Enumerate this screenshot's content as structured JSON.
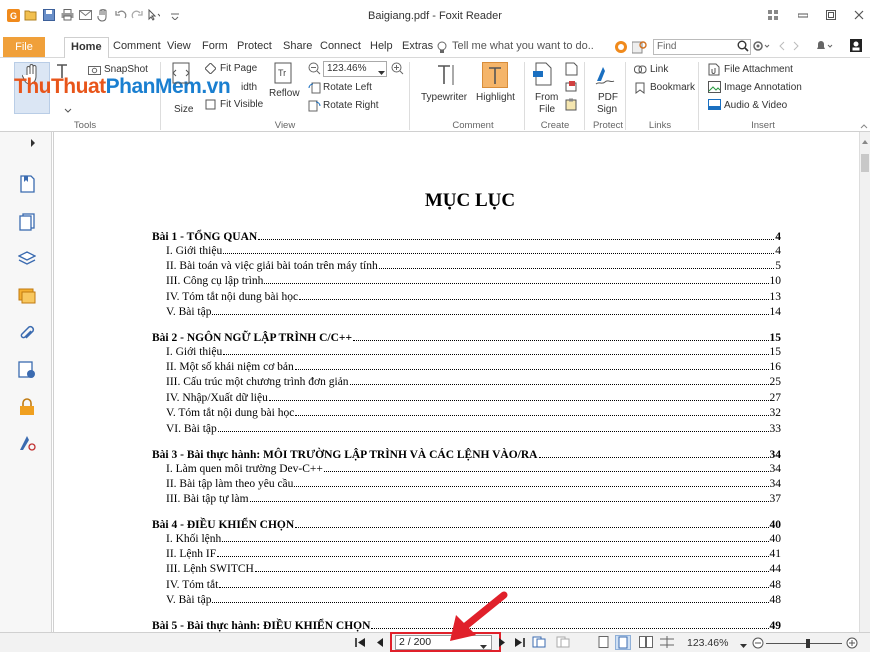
{
  "window": {
    "title": "Baigiang.pdf - Foxit Reader"
  },
  "menu": {
    "file": "File",
    "items": [
      "Home",
      "Comment",
      "View",
      "Form",
      "Protect",
      "Share",
      "Connect",
      "Help",
      "Extras"
    ],
    "tell_me": "Tell me what you want to do..",
    "search_placeholder": "Find"
  },
  "ribbon": {
    "tools": {
      "snapshot": "SnapShot",
      "group": "Tools"
    },
    "view": {
      "fit_page": "Fit Page",
      "fit_width_partial": "idth",
      "fit_visible": "Fit Visible",
      "size_partial": "Size",
      "reflow": "Reflow",
      "zoom": "123.46%",
      "rotate_left": "Rotate Left",
      "rotate_right": "Rotate Right",
      "group": "View"
    },
    "comment": {
      "typewriter": "Typewriter",
      "highlight": "Highlight",
      "group": "Comment"
    },
    "create": {
      "from_file_1": "From",
      "from_file_2": "File",
      "group": "Create"
    },
    "protect": {
      "pdf_sign_1": "PDF",
      "pdf_sign_2": "Sign",
      "group": "Protect"
    },
    "links": {
      "link": "Link",
      "bookmark": "Bookmark",
      "group": "Links"
    },
    "insert": {
      "file_attachment": "File Attachment",
      "image_annotation": "Image Annotation",
      "audio_video": "Audio & Video",
      "group": "Insert"
    }
  },
  "watermark": {
    "part1": "ThuThuat",
    "part2": "PhanMem",
    "part3": ".vn"
  },
  "document": {
    "title": "MỤC LỤC",
    "toc": [
      {
        "text": "Bài 1 - TỔNG QUAN",
        "page": "4",
        "level": "sec"
      },
      {
        "text": "I. Giới thiệu",
        "page": "4",
        "level": "sub"
      },
      {
        "text": "II. Bài toán và việc giải bài toán trên máy tính",
        "page": "5",
        "level": "sub"
      },
      {
        "text": "III. Công cụ lập trình",
        "page": "10",
        "level": "sub"
      },
      {
        "text": "IV. Tóm tắt nội dung bài học",
        "page": "13",
        "level": "sub"
      },
      {
        "text": "V. Bài tập",
        "page": "14",
        "level": "sub"
      },
      {
        "text": "Bài 2 - NGÔN NGỮ LẬP TRÌNH C/C++",
        "page": "15",
        "level": "sec"
      },
      {
        "text": "I. Giới thiệu",
        "page": "15",
        "level": "sub"
      },
      {
        "text": "II. Một số khái niệm cơ bản",
        "page": "16",
        "level": "sub"
      },
      {
        "text": "III. Cấu trúc một chương trình đơn giản",
        "page": "25",
        "level": "sub"
      },
      {
        "text": "IV. Nhập/Xuất dữ liệu",
        "page": "27",
        "level": "sub"
      },
      {
        "text": "V. Tóm tắt nội dung bài học",
        "page": "32",
        "level": "sub"
      },
      {
        "text": "VI. Bài tập",
        "page": "33",
        "level": "sub"
      },
      {
        "text": "Bài 3 - Bài thực hành: MÔI TRƯỜNG LẬP TRÌNH VÀ CÁC LỆNH VÀO/RA",
        "page": "34",
        "level": "sec"
      },
      {
        "text": "I. Làm quen môi trường Dev-C++",
        "page": "34",
        "level": "sub"
      },
      {
        "text": "II. Bài tập làm theo yêu cầu",
        "page": "34",
        "level": "sub"
      },
      {
        "text": "III. Bài tập tự làm",
        "page": "37",
        "level": "sub"
      },
      {
        "text": "Bài 4 - ĐIỀU KHIỂN CHỌN",
        "page": "40",
        "level": "sec"
      },
      {
        "text": "I. Khối lệnh",
        "page": "40",
        "level": "sub"
      },
      {
        "text": "II. Lệnh IF",
        "page": "41",
        "level": "sub"
      },
      {
        "text": "III. Lệnh SWITCH",
        "page": "44",
        "level": "sub"
      },
      {
        "text": "IV. Tóm tắt",
        "page": "48",
        "level": "sub"
      },
      {
        "text": "V. Bài tập",
        "page": "48",
        "level": "sub"
      },
      {
        "text": "Bài 5 - Bài thực hành: ĐIỀU KHIỂN CHỌN",
        "page": "49",
        "level": "sec"
      }
    ]
  },
  "status": {
    "page_indicator": "2 / 200",
    "zoom": "123.46%"
  },
  "colors": {
    "file_tab": "#f0a03a",
    "annotation_red": "#e0202a",
    "watermark_orange": "#e8551a",
    "watermark_blue": "#1a7fd0"
  }
}
